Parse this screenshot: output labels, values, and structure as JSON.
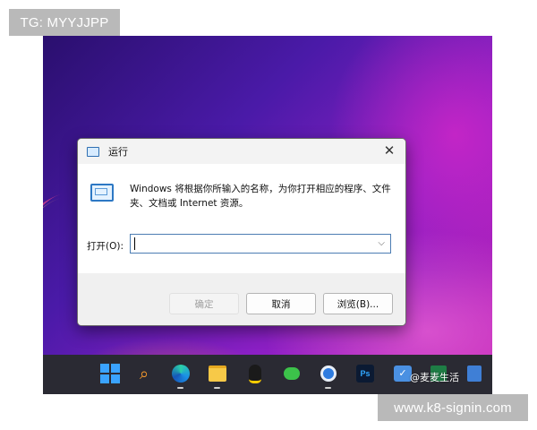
{
  "watermark_top": "TG: MYYJJPP",
  "watermark_bottom": "www.k8-signin.com",
  "dialog": {
    "title": "运行",
    "description": "Windows 将根据你所输入的名称，为你打开相应的程序、文件夹、文档或 Internet 资源。",
    "open_label": "打开(O):",
    "input_value": "",
    "buttons": {
      "ok": "确定",
      "cancel": "取消",
      "browse": "浏览(B)..."
    }
  },
  "taskbar": {
    "icons": [
      "windows-start",
      "search",
      "edge",
      "file-explorer",
      "qq",
      "wechat",
      "chrome",
      "photoshop",
      "bird-app",
      "excel",
      "chart-app"
    ],
    "ps_label": "Ps"
  },
  "corner_watermark": "@麦麦生活"
}
